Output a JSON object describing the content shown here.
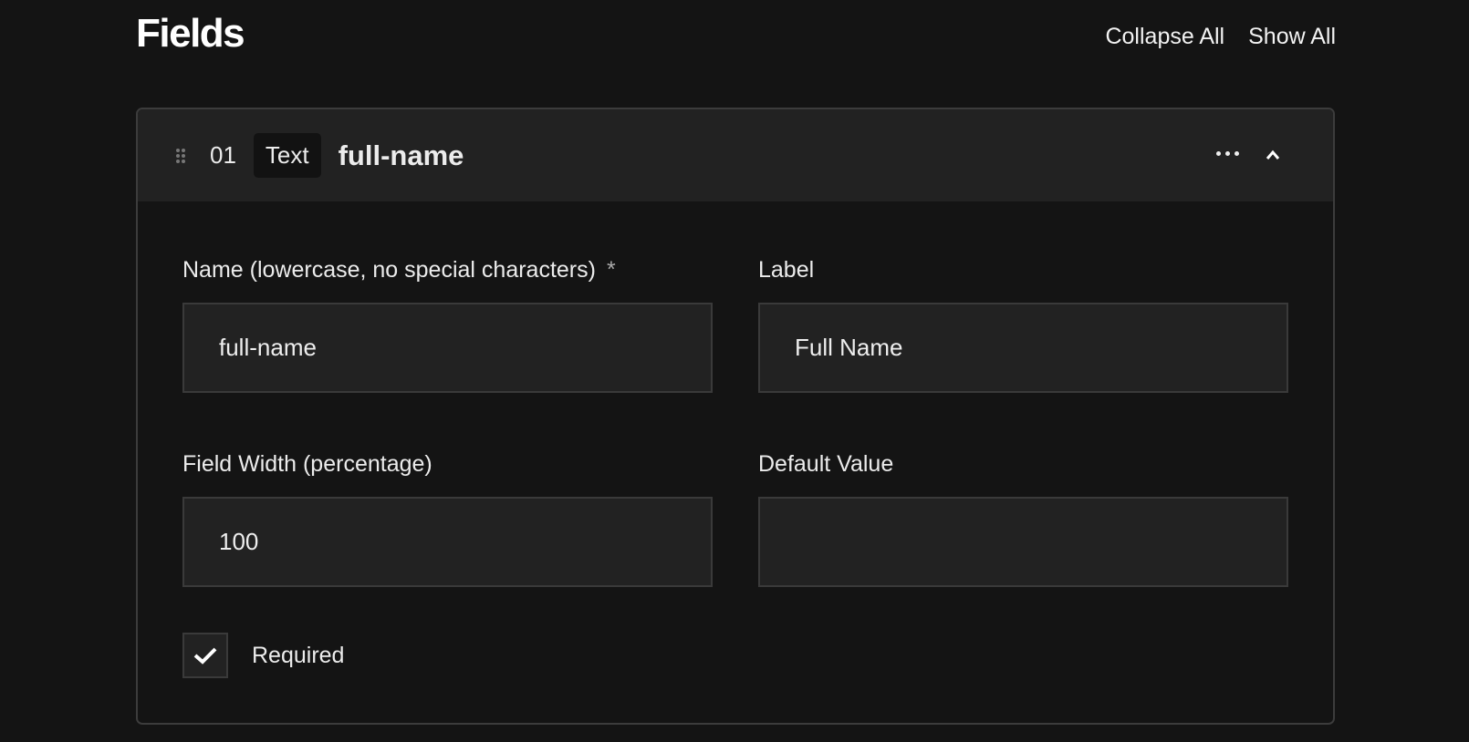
{
  "page": {
    "title": "Fields",
    "collapse_all": "Collapse All",
    "show_all": "Show All"
  },
  "field": {
    "index": "01",
    "type": "Text",
    "name": "full-name",
    "name_label": "Name (lowercase, no special characters)",
    "required_marker": "*",
    "name_value": "full-name",
    "label_label": "Label",
    "label_value": "Full Name",
    "width_label": "Field Width (percentage)",
    "width_value": "100",
    "default_label": "Default Value",
    "default_value": "",
    "required_label": "Required",
    "required_checked": true
  }
}
